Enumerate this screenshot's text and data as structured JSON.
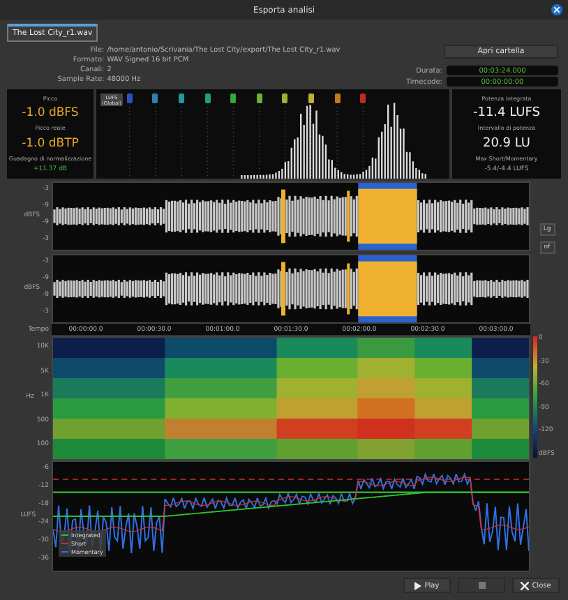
{
  "window": {
    "title": "Esporta analisi"
  },
  "tabs": [
    {
      "label": "The Lost City_r1.wav",
      "selected": true
    }
  ],
  "info": [
    {
      "label": "File:",
      "value": "/home/antonio/Scrivania/The Lost City/export/The Lost City_r1.wav"
    },
    {
      "label": "Formato:",
      "value": "WAV Signed 16 bit PCM"
    },
    {
      "label": "Canali:",
      "value": "2"
    },
    {
      "label": "Sample Rate:",
      "value": "48000 Hz"
    }
  ],
  "open_folder_button": "Apri cartella",
  "time_fields": [
    {
      "label": "Durata:",
      "value": "00:03:24.000"
    },
    {
      "label": "Timecode:",
      "value": "00:00:00:00"
    }
  ],
  "peak_panel": [
    {
      "label": "Picco",
      "value": "-1.0 dBFS",
      "kind": "big"
    },
    {
      "label": "Picco reale",
      "value": "-1.0 dBTP",
      "kind": "big"
    },
    {
      "label": "Guadagno di normalizzazione",
      "value": "+11.37 dB",
      "kind": "small"
    }
  ],
  "histogram": {
    "scale_label": "LUFS (Global)",
    "markers": [
      {
        "color": "#3050c0"
      },
      {
        "color": "#2f7fb0"
      },
      {
        "color": "#239a9a"
      },
      {
        "color": "#23a070"
      },
      {
        "color": "#35a835"
      },
      {
        "color": "#70b030"
      },
      {
        "color": "#a0b030"
      },
      {
        "color": "#c0b030"
      },
      {
        "color": "#c07a20"
      },
      {
        "color": "#c02a20"
      }
    ]
  },
  "loudness_panel": [
    {
      "label": "Potenza integrata",
      "value": "-11.4 LUFS",
      "kind": "big"
    },
    {
      "label": "Intervallo di potenza",
      "value": "20.9 LU",
      "kind": "big"
    },
    {
      "label": "Max Short/Momentary",
      "value": "-5.4/-4.4 LUFS",
      "kind": "small"
    }
  ],
  "waveform": {
    "channels": [
      {
        "axis_label": "dBFS",
        "ticks": [
          "-3",
          "-9",
          "-9",
          "-3"
        ]
      },
      {
        "axis_label": "dBFS",
        "ticks": [
          "-3",
          "-9",
          "-9",
          "-3"
        ]
      }
    ],
    "side_buttons": [
      "Lg",
      "nf"
    ]
  },
  "timeline": {
    "label": "Tempo",
    "times": [
      "00:00:00.0",
      "00:00:30.0",
      "00:01:00.0",
      "00:01:30.0",
      "00:02:00.0",
      "00:02:30.0",
      "00:03:00.0"
    ]
  },
  "spectrogram": {
    "axis_label": "Hz",
    "ticks": [
      "10K",
      "5K",
      "1K",
      "500",
      "100"
    ],
    "scale_ticks": [
      "0",
      "-30",
      "-60",
      "-90",
      "-120"
    ],
    "scale_unit": "dBFS"
  },
  "loudness_graph": {
    "axis_label": "LUFS",
    "ticks": [
      "-6",
      "-12",
      "-18",
      "-24",
      "-30",
      "-36"
    ],
    "legend": [
      {
        "label": "Integrated",
        "color": "#30c030"
      },
      {
        "label": "Short",
        "color": "#d03030"
      },
      {
        "label": "Momentary",
        "color": "#3070e0"
      }
    ]
  },
  "buttons": [
    {
      "kind": "play",
      "label": "Play",
      "disabled": false
    },
    {
      "kind": "stop",
      "disabled": true
    },
    {
      "kind": "close",
      "label": "Close",
      "disabled": false
    }
  ]
}
